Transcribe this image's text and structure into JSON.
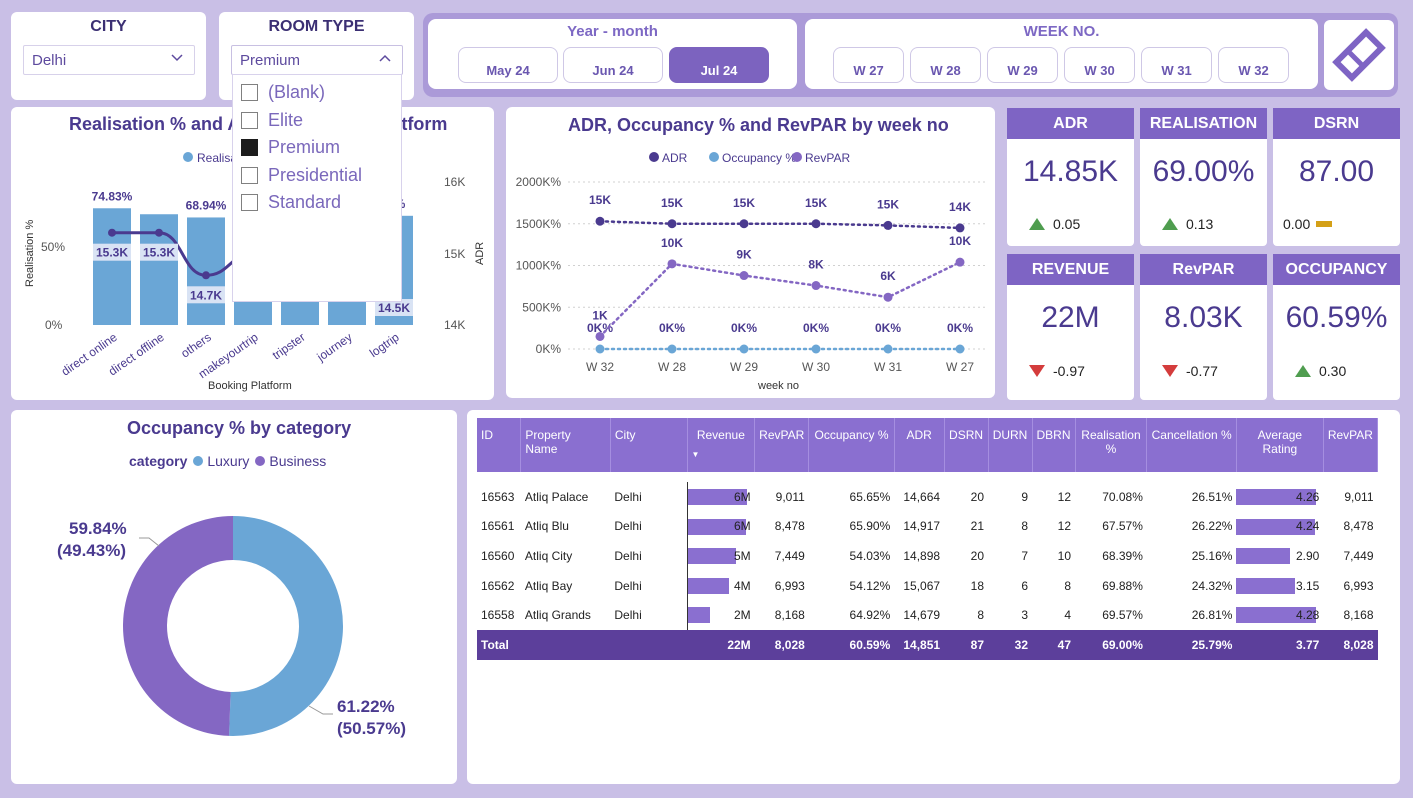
{
  "filters": {
    "city": {
      "title": "CITY",
      "value": "Delhi"
    },
    "room_type": {
      "title": "ROOM TYPE",
      "value": "Premium",
      "options": [
        {
          "label": "(Blank)",
          "checked": false
        },
        {
          "label": "Elite",
          "checked": false
        },
        {
          "label": "Premium",
          "checked": true
        },
        {
          "label": "Presidential",
          "checked": false
        },
        {
          "label": "Standard",
          "checked": false
        }
      ]
    },
    "year_month": {
      "title": "Year - month",
      "buttons": [
        "May 24",
        "Jun 24",
        "Jul 24"
      ],
      "selected": "Jul 24"
    },
    "week_no": {
      "title": "WEEK NO.",
      "buttons": [
        "W 27",
        "W 28",
        "W 29",
        "W 30",
        "W 31",
        "W 32"
      ]
    }
  },
  "kpis": [
    {
      "title": "ADR",
      "value": "14.85K",
      "delta": "0.05",
      "dir": "up"
    },
    {
      "title": "REALISATION",
      "value": "69.00%",
      "delta": "0.13",
      "dir": "up"
    },
    {
      "title": "DSRN",
      "value": "87.00",
      "delta": "0.00",
      "dir": "flat"
    },
    {
      "title": "REVENUE",
      "value": "22M",
      "delta": "-0.97",
      "dir": "down"
    },
    {
      "title": "RevPAR",
      "value": "8.03K",
      "delta": "-0.77",
      "dir": "down"
    },
    {
      "title": "OCCUPANCY",
      "value": "60.59%",
      "delta": "0.30",
      "dir": "up"
    }
  ],
  "colors": {
    "accent": "#7e64c4",
    "bar": "#6aa6d6",
    "line_dark": "#4a3a8f",
    "line_light": "#6aa6d6",
    "line_mid": "#8467c3"
  },
  "chart_realisation": {
    "title": "Realisation % and ADR by Booking Platform",
    "legend": [
      "Realisation %"
    ],
    "xlabel": "Booking Platform",
    "ylabel": "Realisation %",
    "y2label": "ADR",
    "y_ticks": [
      "0%",
      "50%"
    ],
    "y2_ticks": [
      "14K",
      "15K",
      "16K"
    ],
    "chart_data": {
      "type": "bar",
      "categories": [
        "direct online",
        "direct offline",
        "others",
        "makeyourtrip",
        "tripster",
        "journey",
        "logtrip"
      ],
      "realisation_pct": [
        74.83,
        71.0,
        68.94,
        66.0,
        66.0,
        66.0,
        70.0
      ],
      "realisation_labels": [
        "74.83%",
        "",
        "68.94%",
        "",
        "",
        "",
        "…%"
      ],
      "adr": [
        15.3,
        15.3,
        14.7,
        15.0,
        15.0,
        15.0,
        14.5
      ],
      "adr_labels": [
        "15.3K",
        "15.3K",
        "14.7K",
        "",
        "",
        "",
        "14.5K"
      ]
    }
  },
  "chart_weekly": {
    "title": "ADR, Occupancy % and RevPAR by week no",
    "legend": [
      "ADR",
      "Occupancy %",
      "RevPAR"
    ],
    "xlabel": "week no",
    "y_ticks": [
      "0K%",
      "500K%",
      "1000K%",
      "1500K%",
      "2000K%"
    ],
    "chart_data": {
      "type": "line",
      "x": [
        "W 32",
        "W 28",
        "W 29",
        "W 30",
        "W 31",
        "W 27"
      ],
      "ylim": [
        0,
        2000
      ],
      "series": [
        {
          "name": "ADR",
          "values": [
            1530,
            1500,
            1500,
            1500,
            1480,
            1450
          ],
          "labels": [
            "15K",
            "15K",
            "15K",
            "15K",
            "15K",
            "14K"
          ]
        },
        {
          "name": "Occupancy %",
          "values": [
            0,
            0,
            0,
            0,
            0,
            0
          ],
          "labels": [
            "0K%",
            "0K%",
            "0K%",
            "0K%",
            "0K%",
            "0K%"
          ]
        },
        {
          "name": "RevPAR",
          "values": [
            150,
            1020,
            880,
            760,
            620,
            1040
          ],
          "labels": [
            "1K",
            "10K",
            "9K",
            "8K",
            "6K",
            "10K"
          ]
        }
      ]
    }
  },
  "chart_occupancy": {
    "title": "Occupancy % by category",
    "legend_title": "category",
    "legend": [
      "Luxury",
      "Business"
    ],
    "chart_data": {
      "type": "pie",
      "labels": [
        "Luxury",
        "Business"
      ],
      "values": [
        61.22,
        59.84
      ],
      "display": [
        [
          "61.22%",
          "(50.57%)"
        ],
        [
          "59.84%",
          "(49.43%)"
        ]
      ]
    }
  },
  "table": {
    "headers": [
      "ID",
      "Property Name",
      "City",
      "Revenue",
      "RevPAR",
      "Occupancy %",
      "ADR",
      "DSRN",
      "DURN",
      "DBRN",
      "Realisation %",
      "Cancellation %",
      "Average Rating",
      "RevPAR"
    ],
    "rows": [
      {
        "id": "16563",
        "name": "Atliq Palace",
        "city": "Delhi",
        "revenue": "6M",
        "rev_frac": 0.97,
        "revpar": "9,011",
        "occ": "65.65%",
        "adr": "14,664",
        "dsrn": "20",
        "durn": "9",
        "dbrn": "12",
        "real": "70.08%",
        "canc": "26.51%",
        "rating": "4.26",
        "rating_frac": 0.99,
        "revpar2": "9,011"
      },
      {
        "id": "16561",
        "name": "Atliq Blu",
        "city": "Delhi",
        "revenue": "6M",
        "rev_frac": 0.95,
        "revpar": "8,478",
        "occ": "65.90%",
        "adr": "14,917",
        "dsrn": "21",
        "durn": "8",
        "dbrn": "12",
        "real": "67.57%",
        "canc": "26.22%",
        "rating": "4.24",
        "rating_frac": 0.98,
        "revpar2": "8,478"
      },
      {
        "id": "16560",
        "name": "Atliq City",
        "city": "Delhi",
        "revenue": "5M",
        "rev_frac": 0.78,
        "revpar": "7,449",
        "occ": "54.03%",
        "adr": "14,898",
        "dsrn": "20",
        "durn": "7",
        "dbrn": "10",
        "real": "68.39%",
        "canc": "25.16%",
        "rating": "2.90",
        "rating_frac": 0.67,
        "revpar2": "7,449"
      },
      {
        "id": "16562",
        "name": "Atliq Bay",
        "city": "Delhi",
        "revenue": "4M",
        "rev_frac": 0.67,
        "revpar": "6,993",
        "occ": "54.12%",
        "adr": "15,067",
        "dsrn": "18",
        "durn": "6",
        "dbrn": "8",
        "real": "69.88%",
        "canc": "24.32%",
        "rating": "3.15",
        "rating_frac": 0.73,
        "revpar2": "6,993"
      },
      {
        "id": "16558",
        "name": "Atliq Grands",
        "city": "Delhi",
        "revenue": "2M",
        "rev_frac": 0.37,
        "revpar": "8,168",
        "occ": "64.92%",
        "adr": "14,679",
        "dsrn": "8",
        "durn": "3",
        "dbrn": "4",
        "real": "69.57%",
        "canc": "26.81%",
        "rating": "4.28",
        "rating_frac": 0.99,
        "revpar2": "8,168"
      }
    ],
    "total": {
      "label": "Total",
      "revenue": "22M",
      "revpar": "8,028",
      "occ": "60.59%",
      "adr": "14,851",
      "dsrn": "87",
      "durn": "32",
      "dbrn": "47",
      "real": "69.00%",
      "canc": "25.79%",
      "rating": "3.77",
      "revpar2": "8,028"
    }
  }
}
